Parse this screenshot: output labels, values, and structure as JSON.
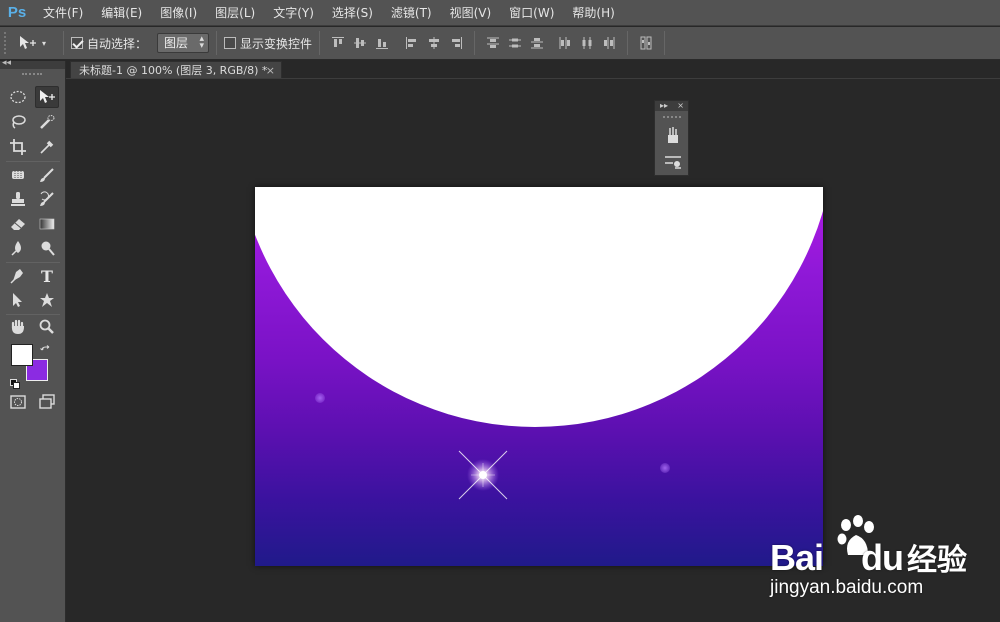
{
  "app": {
    "logo": "Ps",
    "accent_color": "#5ab0e8"
  },
  "menu": [
    {
      "label": "文件(F)"
    },
    {
      "label": "编辑(E)"
    },
    {
      "label": "图像(I)"
    },
    {
      "label": "图层(L)"
    },
    {
      "label": "文字(Y)"
    },
    {
      "label": "选择(S)"
    },
    {
      "label": "滤镜(T)"
    },
    {
      "label": "视图(V)"
    },
    {
      "label": "窗口(W)"
    },
    {
      "label": "帮助(H)"
    }
  ],
  "options_bar": {
    "auto_select_label": "自动选择：",
    "auto_select_checked": true,
    "auto_select_value": "图层",
    "show_transform_label": "显示变换控件",
    "show_transform_checked": false
  },
  "document": {
    "tab_title": "未标题-1 @ 100% (图层 3, RGB/8) *",
    "close_glyph": "×"
  },
  "colors": {
    "foreground": "#ffffff",
    "background": "#8b2be2"
  },
  "tools": [
    {
      "name": "marquee-tool-icon"
    },
    {
      "name": "move-tool-icon",
      "active": true
    },
    {
      "name": "lasso-tool-icon"
    },
    {
      "name": "quick-selection-tool-icon"
    },
    {
      "name": "crop-tool-icon"
    },
    {
      "name": "eyedropper-tool-icon"
    },
    {
      "name": "healing-brush-tool-icon"
    },
    {
      "name": "brush-tool-icon"
    },
    {
      "name": "clone-stamp-tool-icon"
    },
    {
      "name": "history-brush-tool-icon"
    },
    {
      "name": "eraser-tool-icon"
    },
    {
      "name": "gradient-tool-icon"
    },
    {
      "name": "blur-tool-icon"
    },
    {
      "name": "dodge-tool-icon"
    },
    {
      "name": "pen-tool-icon"
    },
    {
      "name": "type-tool-icon"
    },
    {
      "name": "path-selection-tool-icon"
    },
    {
      "name": "custom-shape-tool-icon"
    },
    {
      "name": "hand-tool-icon"
    },
    {
      "name": "zoom-tool-icon"
    }
  ],
  "type_tool_glyph": "T",
  "panel": {
    "collapse_glyph": "▸▸",
    "close_glyph": "×"
  },
  "watermark": {
    "brand_latin": "Bai",
    "brand_du": "du",
    "brand_cn": "经验",
    "url": "jingyan.baidu.com"
  }
}
